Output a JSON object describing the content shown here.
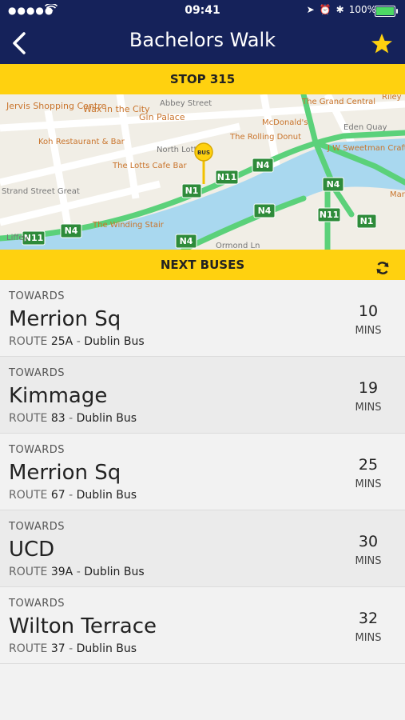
{
  "status": {
    "time": "09:41",
    "battery": "100%"
  },
  "header": {
    "title": "Bachelors Walk"
  },
  "stop": {
    "label": "STOP 315"
  },
  "map": {
    "places": [
      "Jervis Shopping Centre",
      "Wax in the City",
      "Gin Palace",
      "Abbey Street",
      "Koh Restaurant & Bar",
      "North Lotts",
      "The Lotts Cafe Bar",
      "The Winding Stair",
      "The Grand Central",
      "McDonald's",
      "The Rolling Donut",
      "Eden Quay",
      "J W Sweetman Craft Brewery",
      "Riley",
      "Marl",
      "Strand Street Great",
      "Liffey",
      "Ormond Ln"
    ],
    "routes": [
      "N1",
      "N11",
      "N4"
    ],
    "marker": "BUS"
  },
  "next": {
    "label": "NEXT BUSES"
  },
  "buses": [
    {
      "towards": "TOWARDS",
      "destination": "Merrion Sq",
      "route_prefix": "ROUTE",
      "route": "25A",
      "operator": "Dublin Bus",
      "minutes": "10",
      "mins_label": "MINS"
    },
    {
      "towards": "TOWARDS",
      "destination": "Kimmage",
      "route_prefix": "ROUTE",
      "route": "83",
      "operator": "Dublin Bus",
      "minutes": "19",
      "mins_label": "MINS"
    },
    {
      "towards": "TOWARDS",
      "destination": "Merrion Sq",
      "route_prefix": "ROUTE",
      "route": "67",
      "operator": "Dublin Bus",
      "minutes": "25",
      "mins_label": "MINS"
    },
    {
      "towards": "TOWARDS",
      "destination": "UCD",
      "route_prefix": "ROUTE",
      "route": "39A",
      "operator": "Dublin Bus",
      "minutes": "30",
      "mins_label": "MINS"
    },
    {
      "towards": "TOWARDS",
      "destination": "Wilton Terrace",
      "route_prefix": "ROUTE",
      "route": "37",
      "operator": "Dublin Bus",
      "minutes": "32",
      "mins_label": "MINS"
    }
  ],
  "colors": {
    "navy": "#15225a",
    "yellow": "#ffd10f",
    "route_green": "#2e8b3a",
    "river": "#a9d8ef"
  }
}
